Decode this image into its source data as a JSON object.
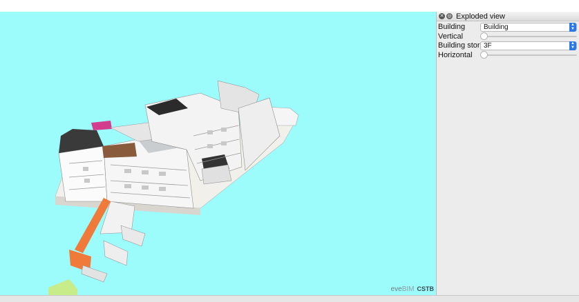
{
  "panel": {
    "title": "Exploded view",
    "fields": {
      "building_label": "Building",
      "building_value": "Building",
      "vertical_label": "Vertical",
      "vertical_value": 0,
      "storey_label": "Building storey",
      "storey_value": "3F",
      "horizontal_label": "Horizontal",
      "horizontal_value": 0
    }
  },
  "viewport": {
    "background": "#9cfbfb",
    "watermark_eve": "eve",
    "watermark_bim": "BIM",
    "watermark_cstb": "CSTB"
  },
  "colors": {
    "accent": "#2a78e4",
    "stairs": "#f07a3a",
    "roof_dark": "#2a2a2a",
    "roof_magenta": "#d23d8e",
    "wood": "#8a5a3c",
    "ground_green": "#c8ec8a"
  },
  "icons": [
    "close-icon",
    "float-icon",
    "chevron-updown-icon"
  ]
}
